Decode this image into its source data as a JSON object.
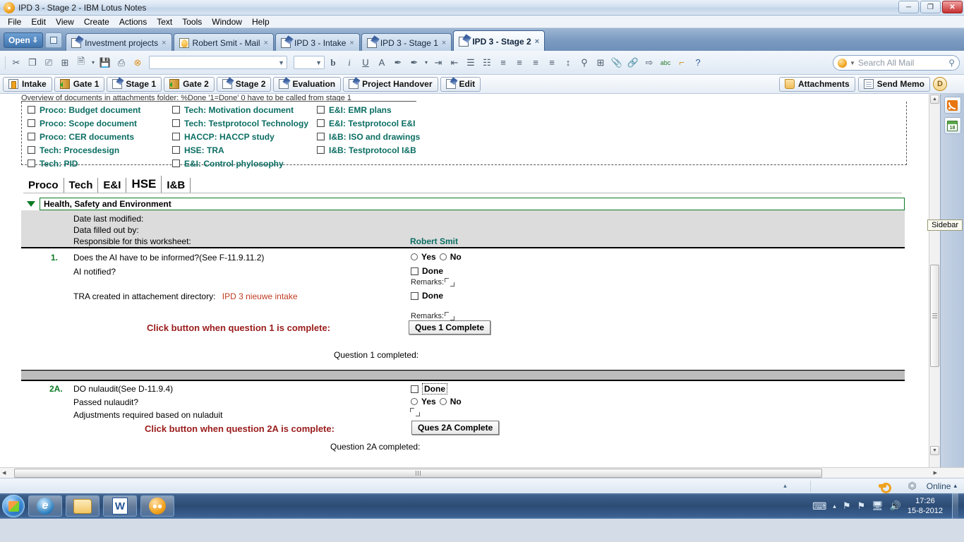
{
  "window": {
    "title": "IPD 3 - Stage 2 - IBM Lotus Notes",
    "logo_icon": "lotus-notes-icon",
    "minimize": "─",
    "maximize": "❐",
    "close": "✕"
  },
  "menu": {
    "items": [
      "File",
      "Edit",
      "View",
      "Create",
      "Actions",
      "Text",
      "Tools",
      "Window",
      "Help"
    ]
  },
  "tabbar": {
    "open_label": "Open",
    "open_arrow": "⇩",
    "window_list_icon": "window-list-icon",
    "tabs": [
      {
        "label": "Investment projects",
        "icon": "document-icon",
        "active": false,
        "close": "×"
      },
      {
        "label": "Robert Smit - Mail",
        "icon": "mail-icon",
        "active": false,
        "close": "×"
      },
      {
        "label": "IPD 3 - Intake",
        "icon": "document-icon",
        "active": false,
        "close": "×"
      },
      {
        "label": "IPD 3 - Stage 1",
        "icon": "document-icon",
        "active": false,
        "close": "×"
      },
      {
        "label": "IPD 3 - Stage 2",
        "icon": "document-icon",
        "active": true,
        "close": "×"
      }
    ]
  },
  "toolbar": {
    "buttons": [
      {
        "icon": "cut-icon",
        "glyph": "✂"
      },
      {
        "icon": "copy-icon",
        "glyph": "❐"
      },
      {
        "icon": "paste-icon",
        "glyph": "Ὄb"
      },
      {
        "icon": "paste-special-icon",
        "glyph": "⊞"
      },
      {
        "icon": "new-document-icon",
        "glyph": "❐"
      },
      {
        "icon": "new-document-dropdown-icon",
        "glyph": "▾"
      },
      {
        "icon": "save-icon",
        "glyph": "Ὃe"
      },
      {
        "icon": "print-icon",
        "glyph": "⎙"
      },
      {
        "icon": "stop-icon",
        "glyph": "⊗"
      }
    ],
    "font_select_value": "",
    "size_select_value": "",
    "format_buttons": [
      {
        "icon": "bold-icon",
        "glyph": "b"
      },
      {
        "icon": "italic-icon",
        "glyph": "i"
      },
      {
        "icon": "underline-icon",
        "glyph": "U"
      },
      {
        "icon": "font-color-icon",
        "glyph": "A"
      },
      {
        "icon": "highlighter-icon",
        "glyph": "✒"
      },
      {
        "icon": "text-highlight-icon",
        "glyph": "✒"
      },
      {
        "icon": "highlight-dropdown-icon",
        "glyph": "▾"
      },
      {
        "icon": "indent-icon",
        "glyph": "⇥"
      },
      {
        "icon": "outdent-icon",
        "glyph": "⇤"
      },
      {
        "icon": "bullet-list-icon",
        "glyph": "☰"
      },
      {
        "icon": "numbered-list-icon",
        "glyph": "☷"
      },
      {
        "icon": "align-left-icon",
        "glyph": "≡"
      },
      {
        "icon": "align-center-icon",
        "glyph": "≡"
      },
      {
        "icon": "align-justify-icon",
        "glyph": "≡"
      },
      {
        "icon": "align-right-icon",
        "glyph": "≡"
      },
      {
        "icon": "line-spacing-icon",
        "glyph": "↕"
      },
      {
        "icon": "find-icon",
        "glyph": "ὐd"
      },
      {
        "icon": "table-icon",
        "glyph": "⊞"
      },
      {
        "icon": "attachment-icon",
        "glyph": "Ὄe"
      },
      {
        "icon": "link-icon",
        "glyph": "ὑ7"
      },
      {
        "icon": "section-icon",
        "glyph": "⇨"
      },
      {
        "icon": "spellcheck-icon",
        "glyph": "abc"
      },
      {
        "icon": "ruler-icon",
        "glyph": "⌐"
      },
      {
        "icon": "help-icon",
        "glyph": "?"
      }
    ],
    "search_placeholder": "Search All Mail",
    "search_value": "",
    "search_icon": "search-icon",
    "search_scope_icon": "search-scope-icon"
  },
  "actionbar": {
    "buttons": [
      {
        "label": "Intake",
        "icon": "intake-page-icon"
      },
      {
        "label": "Gate 1",
        "icon": "gate-door-icon"
      },
      {
        "label": "Stage 1",
        "icon": "stage-pencil-icon"
      },
      {
        "label": "Gate 2",
        "icon": "gate-door-icon"
      },
      {
        "label": "Stage 2",
        "icon": "stage-pencil-icon"
      },
      {
        "label": "Evaluation",
        "icon": "evaluation-pencil-icon"
      },
      {
        "label": "Project Handover",
        "icon": "handover-pencil-icon"
      },
      {
        "label": "Edit",
        "icon": "edit-pencil-icon"
      }
    ],
    "right_buttons": [
      {
        "label": "Attachments",
        "icon": "folder-icon"
      },
      {
        "label": "Send Memo",
        "icon": "memo-icon"
      }
    ],
    "d_badge": "D",
    "notes_badge_icon": "lotus-notes-badge-icon"
  },
  "document": {
    "overview_title": "Overview of documents in attachments folder: %Done '1=Done' 0 have to be called from stage 1",
    "overview_columns": [
      [
        "Proco: Budget document",
        "Proco: Scope document",
        "Proco: CER documents",
        "Tech: Procesdesign",
        "Tech: PID"
      ],
      [
        "Tech: Motivation document",
        "Tech: Testprotocol Technology",
        "HACCP: HACCP study",
        "HSE: TRA",
        "E&I: Control phylosophy"
      ],
      [
        "E&I: EMR plans",
        "E&I: Testprotocol E&I",
        "I&B: ISO and drawings",
        "I&B: Testprotocol I&B"
      ]
    ],
    "form_tabs": [
      {
        "label": "Proco",
        "active": false
      },
      {
        "label": "Tech",
        "active": false
      },
      {
        "label": "E&I",
        "active": false
      },
      {
        "label": "HSE",
        "active": true
      },
      {
        "label": "I&B",
        "active": false
      }
    ],
    "section": {
      "title": "Health, Safety and Environment",
      "collapse_icon": "triangle-down-icon",
      "meta": [
        {
          "label": "Date last modified:",
          "value": ""
        },
        {
          "label": "Data filled out by:",
          "value": ""
        },
        {
          "label": "Responsible for this worksheet:",
          "value": "Robert  Smit"
        }
      ]
    },
    "questions": [
      {
        "number": "1.",
        "text": "Does the AI have to be informed?(See F-11.9.11.2)",
        "yes_label": "Yes",
        "no_label": "No",
        "sub_text": "AI notified?",
        "done_label": "Done",
        "remarks_label": "Remarks:",
        "tra_label": "TRA created in attachement directory:",
        "tra_link": "IPD 3 nieuwe intake",
        "tra_done_label": "Done",
        "remarks_label_2": "Remarks:",
        "complete_prompt": "Click button when question 1 is complete:",
        "complete_button": "Ques 1 Complete",
        "completed_label": "Question 1 completed:",
        "completed_value": ""
      },
      {
        "number": "2A.",
        "text": "DO nulaudit(See D-11.9.4)",
        "done_label": "Done",
        "sub_text": "Passed nulaudit?",
        "yes_label": "Yes",
        "no_label": "No",
        "adjust_text": "Adjustments required based on nuladuit",
        "complete_prompt": "Click button when question 2A is complete:",
        "complete_button": "Ques 2A Complete",
        "completed_label": "Question 2A completed:"
      }
    ]
  },
  "sidebar": {
    "icons": [
      {
        "name": "rss-feeds-icon"
      },
      {
        "name": "calendar-icon",
        "day": "18"
      }
    ],
    "tooltip": "Sidebar"
  },
  "statusbar": {
    "expand_arrow": "▴",
    "key_icon": "key-icon",
    "location_icon": "location-icon",
    "online_label": "Online",
    "online_arrow": "▴"
  },
  "taskbar": {
    "start_icon": "windows-start-icon",
    "items": [
      {
        "name": "internet-explorer-icon",
        "glyph": "e"
      },
      {
        "name": "windows-explorer-icon",
        "glyph": ""
      },
      {
        "name": "microsoft-word-icon",
        "glyph": "W"
      },
      {
        "name": "lotus-notes-icon",
        "glyph": "⚭"
      }
    ],
    "tray": [
      {
        "name": "keyboard-icon",
        "glyph": "⌨"
      },
      {
        "name": "show-hidden-icons-icon",
        "glyph": "▴"
      },
      {
        "name": "network-flag-icon",
        "glyph": "⚑"
      },
      {
        "name": "action-center-icon",
        "glyph": "⚑"
      },
      {
        "name": "network-icon",
        "glyph": "὚5"
      },
      {
        "name": "volume-icon",
        "glyph": "ὐa"
      }
    ],
    "time": "17:26",
    "date": "15-8-2012"
  },
  "scroll": {
    "vertical_up": "▲",
    "vertical_down": "▼",
    "horizontal_left": "◀",
    "horizontal_right": "▶"
  }
}
